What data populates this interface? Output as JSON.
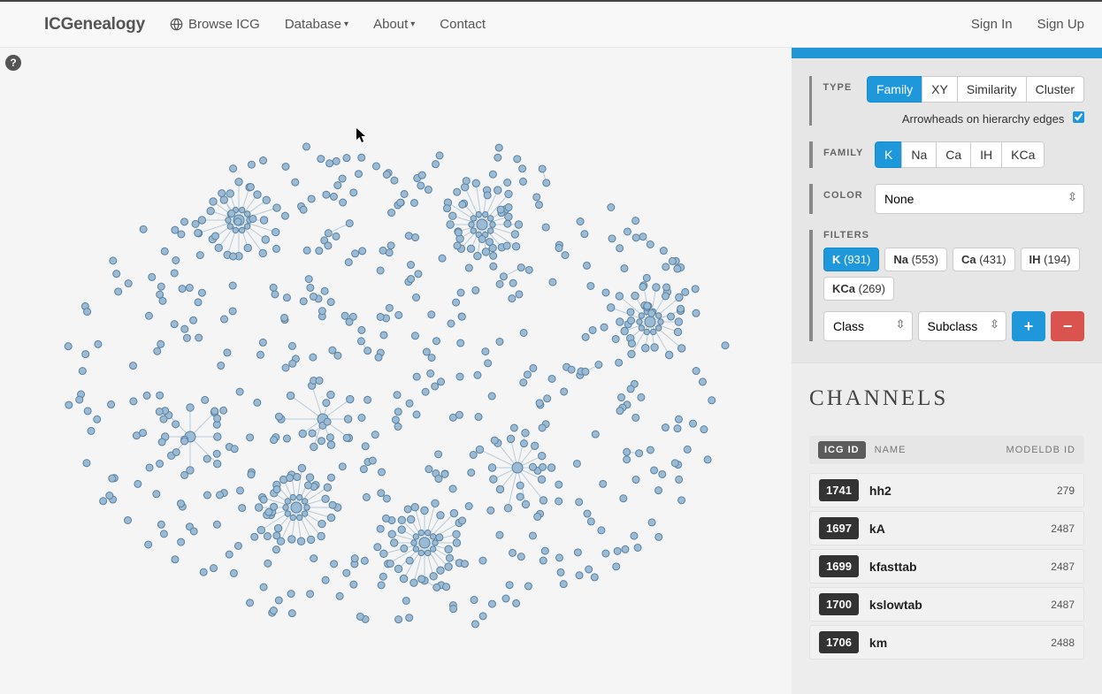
{
  "nav": {
    "brand": "ICGenealogy",
    "items": [
      "Browse ICG",
      "Database",
      "About",
      "Contact"
    ],
    "dropdown": [
      false,
      true,
      true,
      false
    ],
    "signin": "Sign In",
    "signup": "Sign Up"
  },
  "help_icon": "?",
  "controls": {
    "type": {
      "label": "TYPE",
      "options": [
        "Family",
        "XY",
        "Similarity",
        "Cluster"
      ],
      "active": 0,
      "arrowheads_label": "Arrowheads on hierarchy edges",
      "arrowheads_checked": true
    },
    "family": {
      "label": "FAMILY",
      "options": [
        "K",
        "Na",
        "Ca",
        "IH",
        "KCa"
      ],
      "active": 0
    },
    "color": {
      "label": "COLOR",
      "value": "None"
    },
    "filters": {
      "label": "FILTERS",
      "pills": [
        {
          "name": "K",
          "count": "(931)",
          "active": true
        },
        {
          "name": "Na",
          "count": "(553)",
          "active": false
        },
        {
          "name": "Ca",
          "count": "(431)",
          "active": false
        },
        {
          "name": "IH",
          "count": "(194)",
          "active": false
        },
        {
          "name": "KCa",
          "count": "(269)",
          "active": false
        }
      ],
      "class_select": "Class",
      "subclass_select": "Subclass",
      "plus": "+",
      "minus": "−"
    }
  },
  "channels": {
    "title": "CHANNELS",
    "header": {
      "icg": "ICG ID",
      "name": "NAME",
      "modeldb": "MODELDB ID"
    },
    "rows": [
      {
        "id": "1741",
        "name": "hh2",
        "mdb": "279"
      },
      {
        "id": "1697",
        "name": "kA",
        "mdb": "2487"
      },
      {
        "id": "1699",
        "name": "kfasttab",
        "mdb": "2487"
      },
      {
        "id": "1700",
        "name": "kslowtab",
        "mdb": "2487"
      },
      {
        "id": "1706",
        "name": "km",
        "mdb": "2488"
      }
    ]
  }
}
